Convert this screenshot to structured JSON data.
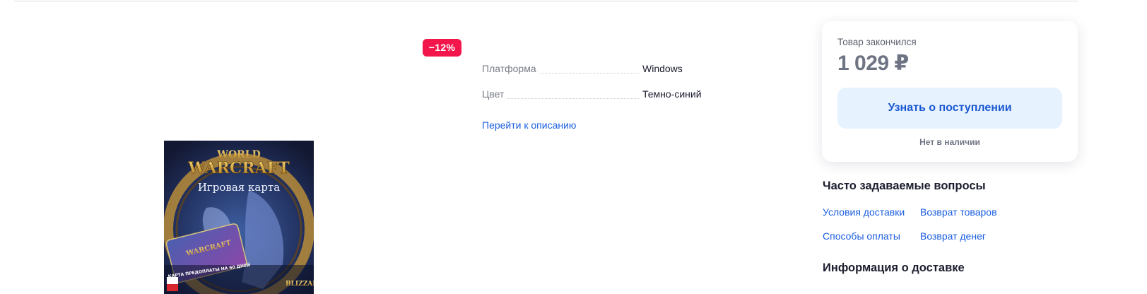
{
  "product": {
    "discount_badge": "−12%",
    "image": {
      "title_line1": "WORLD",
      "title_line2": "WARCRAFT",
      "subtitle": "Игровая карта",
      "card_caption": "КАРТА ПРЕДОПЛАТЫ НА 60 ДНЕЙ",
      "card_logo": "WARCRAFT",
      "publisher": "BLIZZARD"
    }
  },
  "specs": {
    "rows": [
      {
        "label": "Платформа",
        "value": "Windows"
      },
      {
        "label": "Цвет",
        "value": "Темно-синий"
      }
    ],
    "description_link": "Перейти к описанию"
  },
  "buy_card": {
    "status": "Товар закончился",
    "price": "1 029 ₽",
    "notify_button": "Узнать о поступлении",
    "availability": "Нет в наличии"
  },
  "faq": {
    "title": "Часто задаваемые вопросы",
    "links": [
      "Условия доставки",
      "Возврат товаров",
      "Способы оплаты",
      "Возврат денег"
    ]
  },
  "delivery": {
    "title": "Информация о доставке"
  },
  "colors": {
    "badge": "#f2164b",
    "link": "#1b5ee0",
    "button_bg": "#e6f3ff",
    "button_text": "#1a57d1",
    "price": "#6e7484"
  },
  "icons": []
}
